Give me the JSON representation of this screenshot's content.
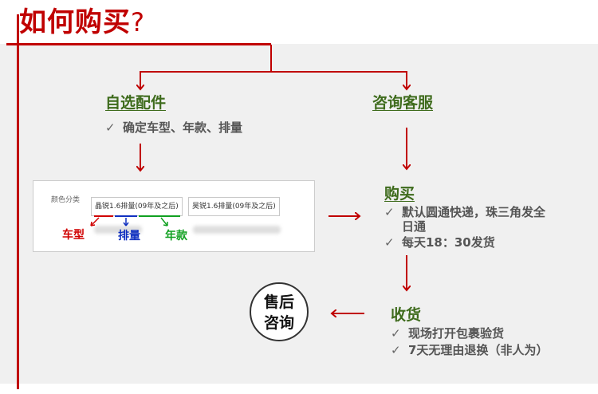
{
  "title": {
    "main": "如何购买",
    "mark": "?"
  },
  "step_select": {
    "heading": "自选配件",
    "items": [
      "确定车型、年款、排量"
    ]
  },
  "step_consult": {
    "heading": "咨询客服"
  },
  "step_buy": {
    "heading": "购买",
    "items": [
      "默认圆通快递，珠三角发全日通",
      "每天18：30发货"
    ]
  },
  "step_receive": {
    "heading": "收货",
    "items": [
      "现场打开包裹验货",
      "7天无理由退换（非人为）"
    ]
  },
  "after_sale": {
    "line1": "售后",
    "line2": "咨询"
  },
  "product_example": {
    "label": "颜色分类",
    "options": [
      "晶锐1.6排量(09年及之后)",
      "昊锐1.6排量(09年及之后)"
    ],
    "tags": {
      "model": "车型",
      "displacement": "排量",
      "year": "年款"
    }
  },
  "colors": {
    "accent_red": "#c00000",
    "heading_green": "#3e6b1c",
    "panel_gray": "#f0f0f0"
  },
  "icons": [
    "check-icon",
    "arrow-down-icon",
    "arrow-right-icon",
    "arrow-left-icon"
  ]
}
